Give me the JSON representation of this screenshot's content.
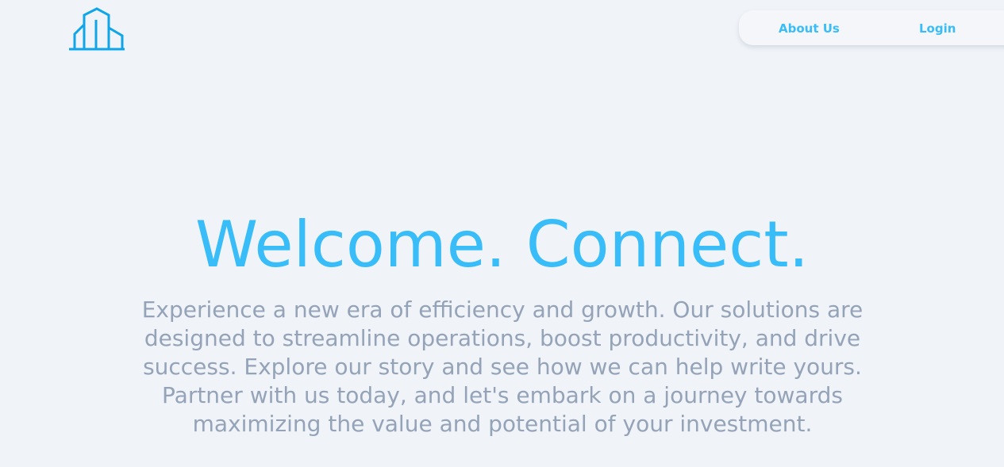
{
  "header": {
    "logo_icon": "building-icon",
    "nav": {
      "about_label": "About Us",
      "login_label": "Login"
    }
  },
  "hero": {
    "title": "Welcome. Connect.",
    "description": "Experience a new era of efficiency and growth. Our solutions are designed to streamline operations, boost productivity, and drive success. Explore our story and see how we can help write yours. Partner with us today, and let's embark on a journey towards maximizing the value and potential of your investment."
  },
  "colors": {
    "background": "#f0f3f8",
    "accent": "#38bdf8",
    "logo": "#0ea5e9",
    "body_text": "#94a3b8"
  }
}
